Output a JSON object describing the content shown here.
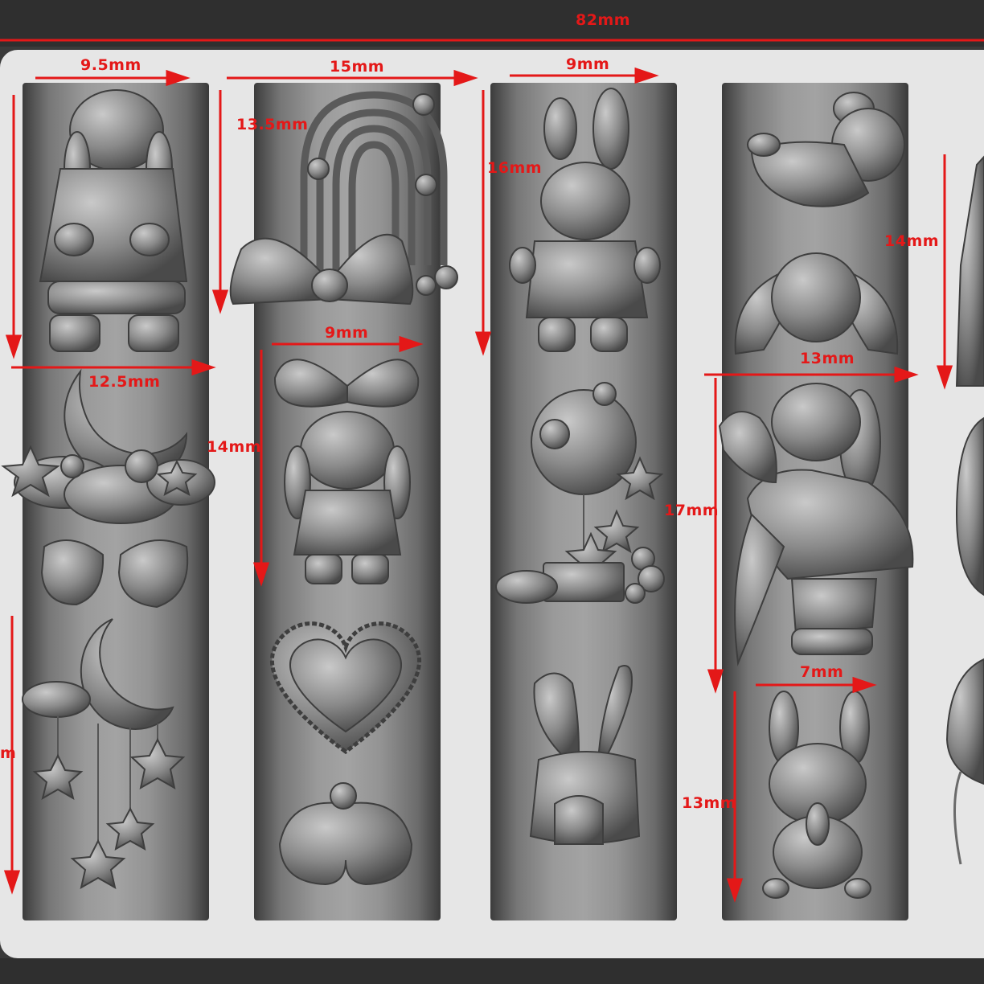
{
  "title": "82mm",
  "colors": {
    "accent": "#e41818",
    "relief": "#8e8e8e",
    "background": "#e6e6e6",
    "frame": "#2f2f2f"
  },
  "dimensions": {
    "d1": "9.5mm",
    "d2": "15mm",
    "d3": "9mm",
    "d4": "13.5mm",
    "d5": "16mm",
    "d6": "14mm",
    "d7": "12.5mm",
    "d8": "14mm",
    "d9": "9mm",
    "d10": "13mm",
    "d11": "17mm",
    "d12": "7mm",
    "d13": "13mm",
    "d14": "m"
  },
  "columns": [
    {
      "motifs": [
        "bunny-in-dress",
        "moon-with-clouds-and-stars",
        "strawberries",
        "moon-mobile-with-hanging-stars"
      ]
    },
    {
      "motifs": [
        "rainbow-with-bow-and-strawberries",
        "bunny-with-big-bow",
        "ruffled-heart",
        "bunny-bottom"
      ]
    },
    {
      "motifs": [
        "bunny-with-bonnet",
        "balloon-tree-with-stars",
        "carrot-house"
      ]
    },
    {
      "motifs": [
        "lying-bunny",
        "lop-ear-bunny-face",
        "bunny-holding-carrot",
        "bunny-eating-carrot"
      ]
    }
  ]
}
